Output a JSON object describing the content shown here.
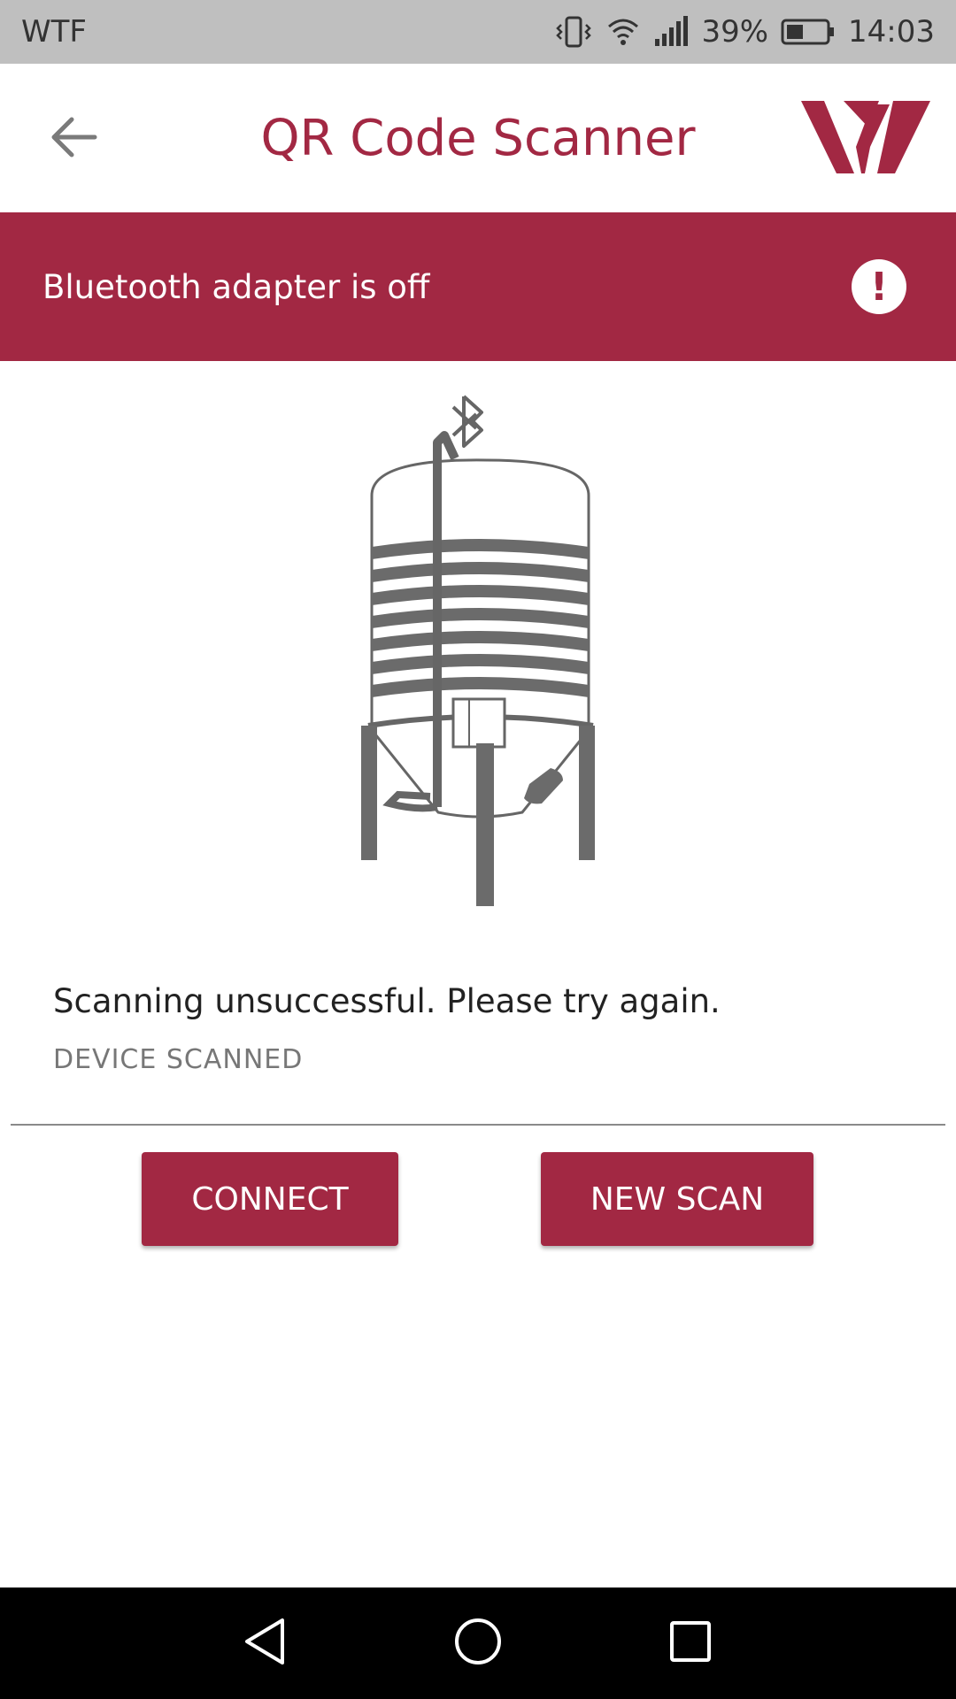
{
  "status_bar": {
    "carrier": "WTF",
    "battery": "39%",
    "time": "14:03",
    "icons": [
      "vibrate-icon",
      "wifi-icon",
      "signal-icon",
      "battery-icon"
    ]
  },
  "header": {
    "title": "QR Code Scanner",
    "back_icon": "arrow-left-icon",
    "logo_icon": "brand-logo"
  },
  "alert": {
    "message": "Bluetooth adapter is off",
    "icon": "exclamation-icon",
    "glyph": "!"
  },
  "illustration": {
    "icon": "silo-with-bluetooth-sensor"
  },
  "result": {
    "message": "Scanning unsuccessful. Please try again.",
    "label": "DEVICE SCANNED"
  },
  "buttons": {
    "connect": "CONNECT",
    "new_scan": "NEW SCAN"
  },
  "nav": {
    "icons": [
      "nav-back-icon",
      "nav-home-icon",
      "nav-recent-icon"
    ]
  },
  "colors": {
    "accent": "#a22843",
    "status_bar": "#bfbfbf",
    "nav_bar": "#000000"
  }
}
